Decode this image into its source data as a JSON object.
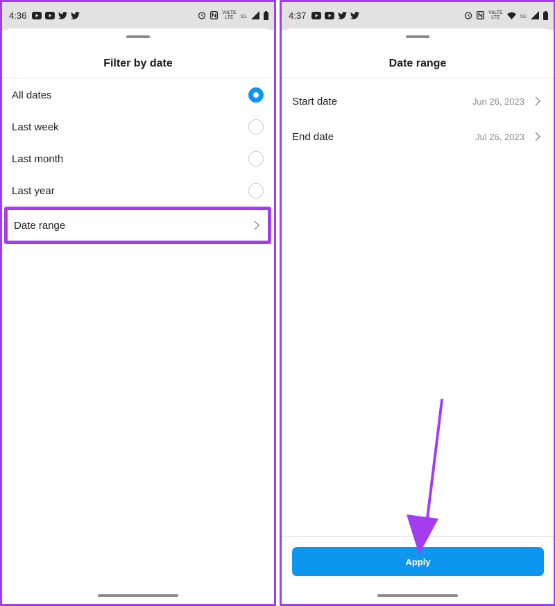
{
  "colors": {
    "accent": "#0c96ef",
    "annotation": "#a43df0",
    "status_bar_bg": "#e2e2e2"
  },
  "left_screen": {
    "status_bar": {
      "time": "4:36",
      "icons": [
        "youtube-icon",
        "youtube-icon",
        "twitter-icon",
        "twitter-icon",
        "alarm-icon",
        "nfc-icon",
        "volte-icon",
        "wifi-icon",
        "signal-icon",
        "battery-icon"
      ],
      "volte_line1": "VoLTE",
      "volte_line2": "LTE",
      "network": "5G"
    },
    "sheet": {
      "title": "Filter by date",
      "options": [
        {
          "label": "All dates",
          "selected": true
        },
        {
          "label": "Last week",
          "selected": false
        },
        {
          "label": "Last month",
          "selected": false
        },
        {
          "label": "Last year",
          "selected": false
        }
      ],
      "date_range_label": "Date range"
    }
  },
  "right_screen": {
    "status_bar": {
      "time": "4:37",
      "icons": [
        "youtube-icon",
        "youtube-icon",
        "twitter-icon",
        "twitter-icon",
        "alarm-icon",
        "nfc-icon",
        "volte-icon",
        "wifi-icon",
        "signal-icon",
        "battery-icon"
      ],
      "volte_line1": "VoLTE",
      "volte_line2": "LTE",
      "network": "5G"
    },
    "sheet": {
      "title": "Date range",
      "start_label": "Start date",
      "start_value": "Jun 26, 2023",
      "end_label": "End date",
      "end_value": "Jul 26, 2023",
      "apply_label": "Apply"
    }
  }
}
